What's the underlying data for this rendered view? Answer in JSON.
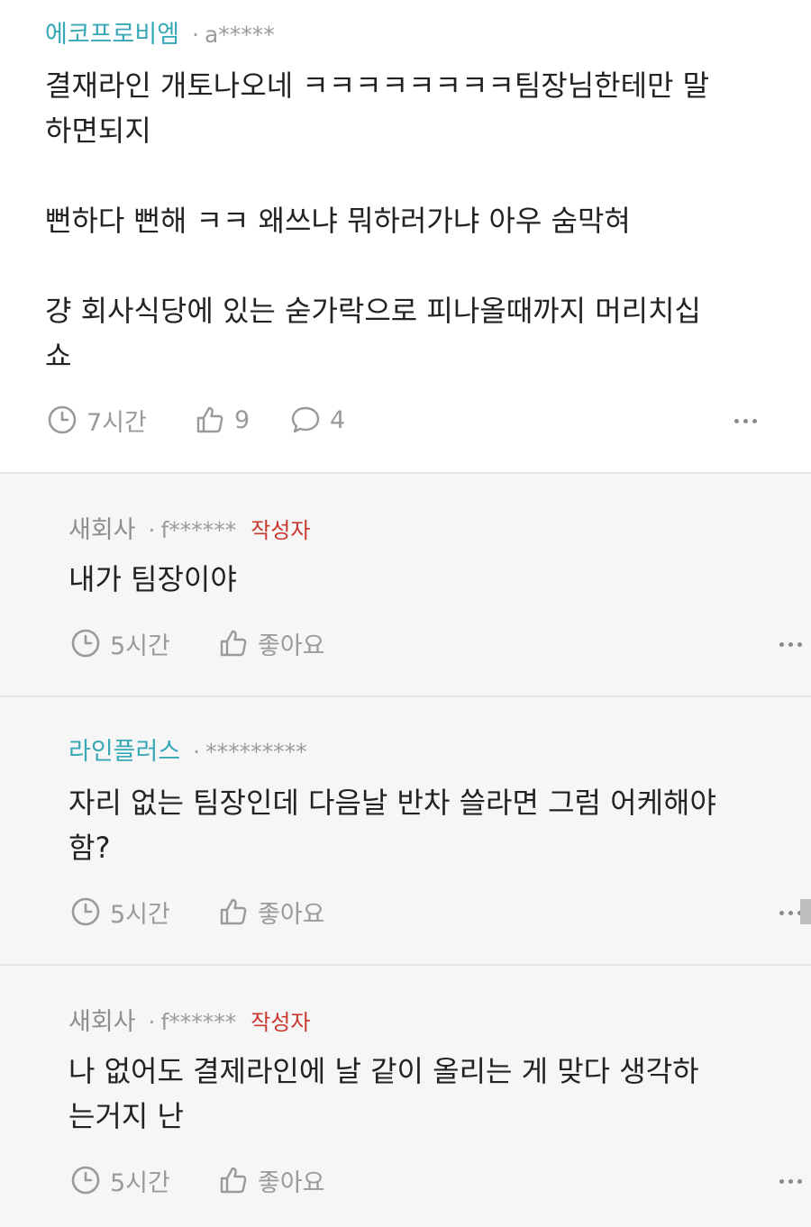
{
  "comments": [
    {
      "company": "에코프로비엠",
      "separator": "·",
      "user": "a*****",
      "text": "결재라인 개토나오네 ㅋㅋㅋㅋㅋㅋㅋㅋ팀장님한테만 말\n하면되지\n\n뻔하다 뻔해 ㅋㅋ 왜쓰냐 뭐하러가냐 아우 숨막혀\n\n걍 회사식당에 있는 숟가락으로 피나올때까지 머리치십\n쇼",
      "time": "7시간",
      "likes": "9",
      "replies": "4"
    },
    {
      "company": "새회사",
      "separator": "·",
      "user": "f******",
      "author_tag": "작성자",
      "text": "내가 팀장이야",
      "time": "5시간",
      "likes": "좋아요"
    },
    {
      "company": "라인플러스",
      "separator": "·",
      "user": "*********",
      "text": "자리 없는 팀장인데 다음날 반차 쓸라면 그럼 어케해야\n함?",
      "time": "5시간",
      "likes": "좋아요"
    },
    {
      "company": "새회사",
      "separator": "·",
      "user": "f******",
      "author_tag": "작성자",
      "text": "나 없어도 결제라인에 날 같이 올리는 게 맞다 생각하\n는거지 난",
      "time": "5시간",
      "likes": "좋아요"
    }
  ],
  "icons": {
    "time": "clock-icon",
    "like": "thumbs-up-icon",
    "reply": "speech-bubble-icon",
    "more": "more-dots-icon"
  },
  "colors": {
    "company_teal": "#37a8b6",
    "author_tag": "#c8382e",
    "reply_bg": "#f6f6f6"
  }
}
